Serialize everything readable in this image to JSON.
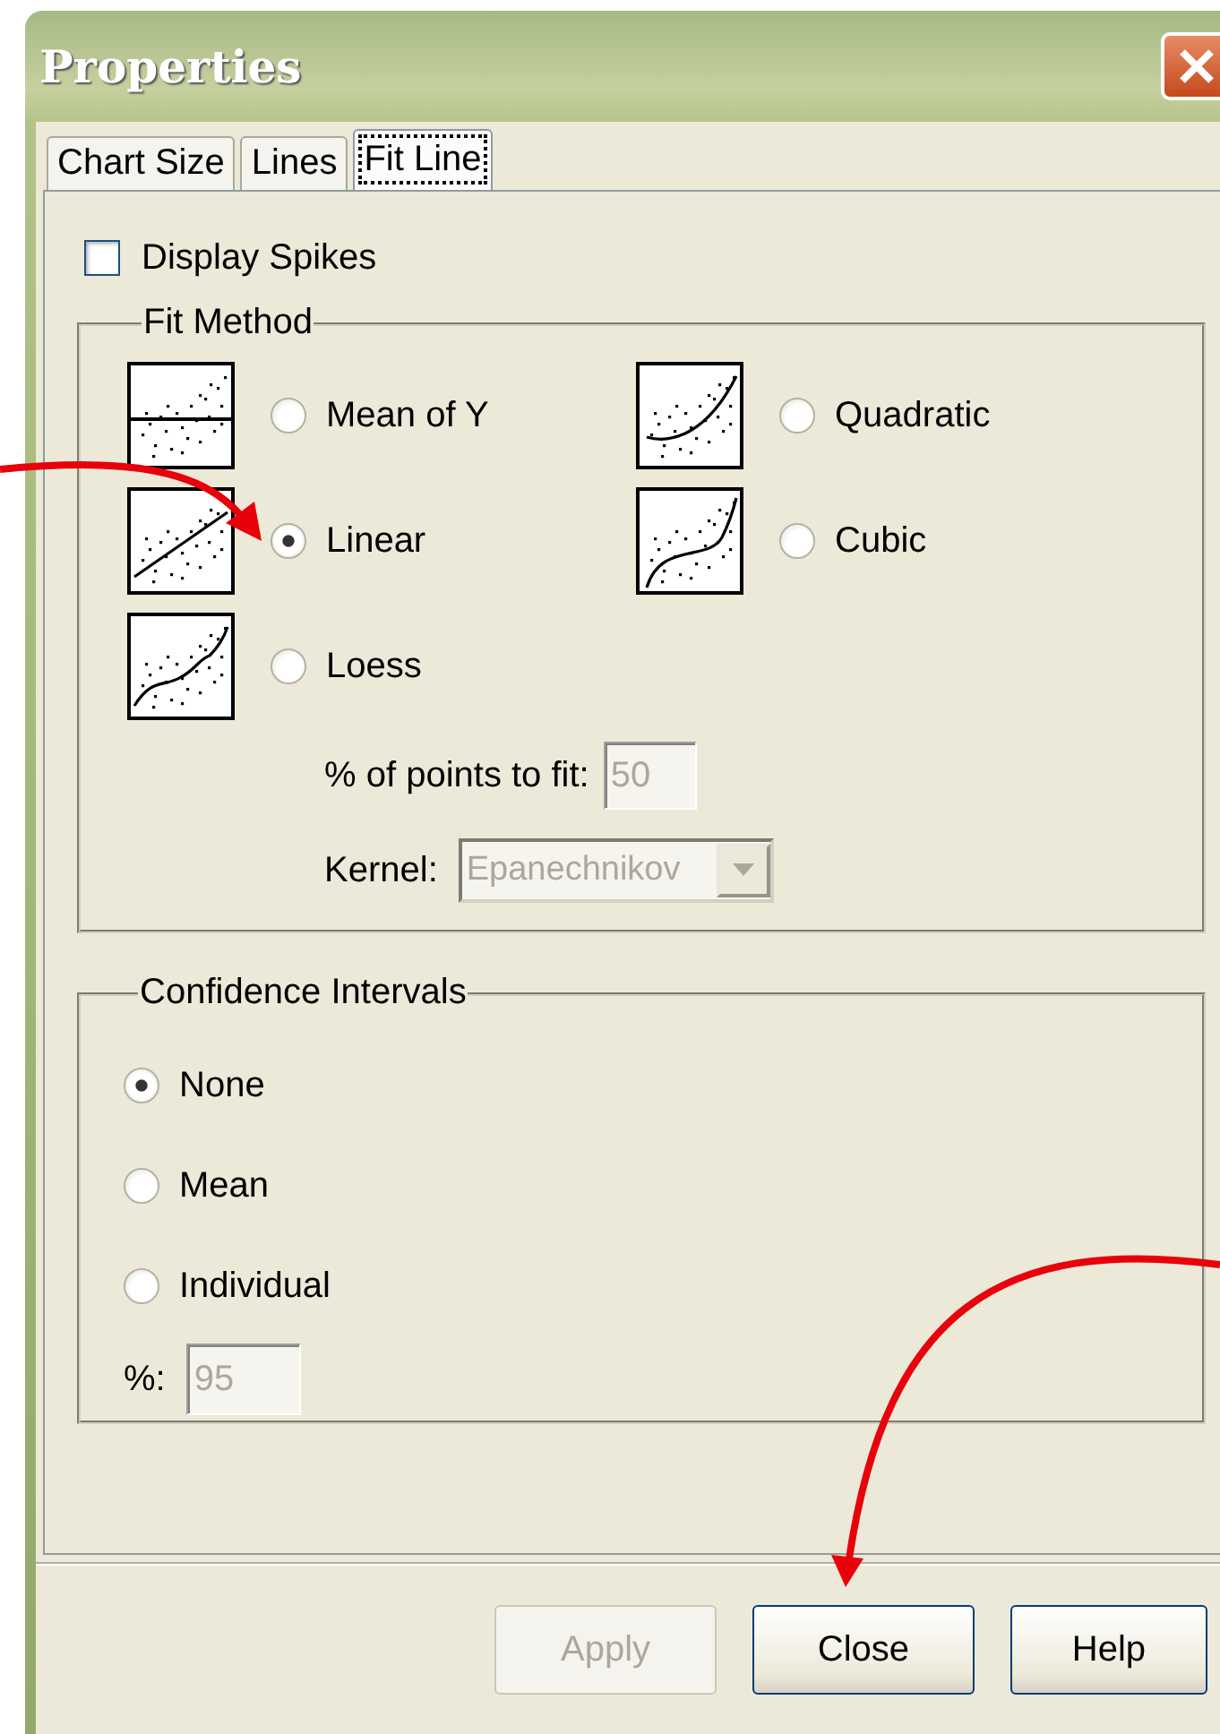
{
  "window": {
    "title": "Properties"
  },
  "tabs": [
    {
      "label": "Chart Size",
      "selected": false
    },
    {
      "label": "Lines",
      "selected": false
    },
    {
      "label": "Fit Line",
      "selected": true
    }
  ],
  "display_spikes": {
    "label": "Display Spikes",
    "checked": false
  },
  "fit_method": {
    "title": "Fit Method",
    "options": [
      {
        "label": "Mean of Y",
        "kind": "mean",
        "selected": false
      },
      {
        "label": "Quadratic",
        "kind": "quadratic",
        "selected": false
      },
      {
        "label": "Linear",
        "kind": "linear",
        "selected": true
      },
      {
        "label": "Cubic",
        "kind": "cubic",
        "selected": false
      },
      {
        "label": "Loess",
        "kind": "loess",
        "selected": false
      }
    ],
    "points_to_fit": {
      "label": "% of points to fit:",
      "value": "50",
      "disabled": true
    },
    "kernel": {
      "label": "Kernel:",
      "value": "Epanechnikov",
      "disabled": true
    }
  },
  "confidence_intervals": {
    "title": "Confidence Intervals",
    "options": [
      {
        "label": "None",
        "selected": true
      },
      {
        "label": "Mean",
        "selected": false
      },
      {
        "label": "Individual",
        "selected": false
      }
    ],
    "percent": {
      "label": "%:",
      "value": "95",
      "disabled": true
    }
  },
  "buttons": [
    {
      "label": "Apply",
      "disabled": true
    },
    {
      "label": "Close",
      "disabled": false
    },
    {
      "label": "Help",
      "disabled": false
    }
  ]
}
